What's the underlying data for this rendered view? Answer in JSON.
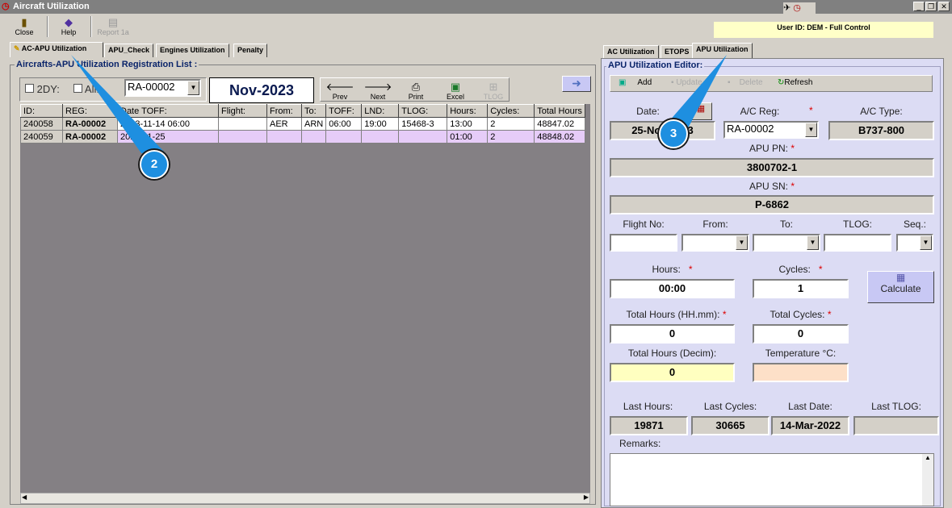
{
  "window": {
    "title": "Aircraft Utilization",
    "user": "User ID: DEM - Full Control"
  },
  "toolbar": {
    "close": "Close",
    "help": "Help",
    "report": "Report 1a"
  },
  "left_tabs": [
    "AC-APU Utilization",
    "APU_Check",
    "Engines Utilization",
    "Penalty"
  ],
  "right_tabs": [
    "AC Utilization",
    "ETOPS",
    "APU Utilization"
  ],
  "list": {
    "title": "Aircrafts-APU Utilization Registration List :",
    "chk_2dy": "2DY:",
    "chk_all": "All:",
    "reg": "RA-00002",
    "period": "Nov-2023",
    "buttons": {
      "prev": "Prev",
      "next": "Next",
      "print": "Print",
      "excel": "Excel",
      "tlog": "TLOG"
    },
    "columns": [
      "ID:",
      "REG:",
      "Date TOFF:",
      "Flight:",
      "From:",
      "To:",
      "TOFF:",
      "LND:",
      "TLOG:",
      "Hours:",
      "Cycles:",
      "Total Hours"
    ],
    "rows": [
      [
        "240058",
        "RA-00002",
        "2023-11-14 06:00",
        "",
        "AER",
        "ARN",
        "06:00",
        "19:00",
        "15468-3",
        "13:00",
        "2",
        "48847.02"
      ],
      [
        "240059",
        "RA-00002",
        "2023-11-25",
        "",
        "",
        "",
        "",
        "",
        "",
        "01:00",
        "2",
        "48848.02"
      ]
    ]
  },
  "editor": {
    "title": "APU Utilization Editor:",
    "buttons": {
      "add": "Add",
      "update": "Update",
      "delete": "Delete",
      "refresh": "Refresh"
    },
    "date_label": "Date:",
    "date": "25-Nov-2023",
    "acreg_label": "A/C Reg:",
    "acreg": "RA-00002",
    "actype_label": "A/C Type:",
    "actype": "B737-800",
    "apupn_label": "APU PN:",
    "apupn": "3800702-1",
    "apusn_label": "APU SN:",
    "apusn": "P-6862",
    "flight_label": "Flight No:",
    "from_label": "From:",
    "to_label": "To:",
    "tlog_label": "TLOG:",
    "seq_label": "Seq.:",
    "hours_label": "Hours:",
    "hours": "00:00",
    "cycles_label": "Cycles:",
    "cycles": "1",
    "calculate": "Calculate",
    "tothours_label": "Total Hours (HH.mm):",
    "tothours": "0",
    "totcycles_label": "Total Cycles:",
    "totcycles": "0",
    "totdec_label": "Total Hours (Decim):",
    "totdec": "0",
    "temp_label": "Temperature °C:",
    "last_hours_label": "Last Hours:",
    "last_hours": "19871",
    "last_cycles_label": "Last Cycles:",
    "last_cycles": "30665",
    "last_date_label": "Last Date:",
    "last_date": "14-Mar-2022",
    "last_tlog_label": "Last TLOG:",
    "last_tlog": "",
    "remarks_label": "Remarks:"
  },
  "callouts": {
    "c2": "2",
    "c3": "3"
  },
  "required": "*"
}
